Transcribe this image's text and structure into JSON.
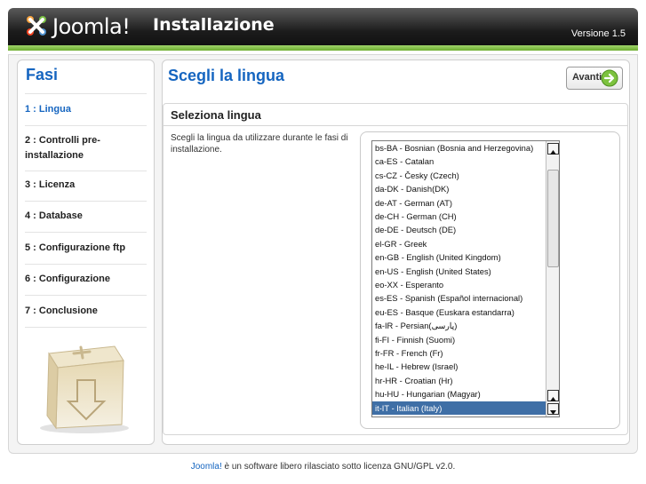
{
  "header": {
    "logo_text": "Joomla!",
    "title": "Installazione",
    "version": "Versione 1.5"
  },
  "sidebar": {
    "title": "Fasi",
    "steps": [
      {
        "label": "1 : Lingua"
      },
      {
        "label": "2 : Controlli pre-installazione"
      },
      {
        "label": "3 : Licenza"
      },
      {
        "label": "4 : Database"
      },
      {
        "label": "5 : Configurazione ftp"
      },
      {
        "label": "6 : Configurazione"
      },
      {
        "label": "7 : Conclusione"
      }
    ]
  },
  "content": {
    "title": "Scegli la lingua",
    "next_label": "Avanti",
    "section_title": "Seleziona lingua",
    "description": "Scegli la lingua da utilizzare durante le fasi di installazione."
  },
  "language_list": {
    "options": [
      "bs-BA - Bosnian (Bosnia and Herzegovina)",
      "ca-ES - Catalan",
      "cs-CZ - Česky (Czech)",
      "da-DK - Danish(DK)",
      "de-AT - German (AT)",
      "de-CH - German (CH)",
      "de-DE - Deutsch (DE)",
      "el-GR - Greek",
      "en-GB - English (United Kingdom)",
      "en-US - English (United States)",
      "eo-XX - Esperanto",
      "es-ES - Spanish (Español internacional)",
      "eu-ES - Basque (Euskara estandarra)",
      "fa-IR - Persian(پارسی)",
      "fi-FI - Finnish (Suomi)",
      "fr-FR - French (Fr)",
      "he-IL - Hebrew (Israel)",
      "hr-HR - Croatian (Hr)",
      "hu-HU - Hungarian (Magyar)",
      "it-IT - Italian (Italy)"
    ],
    "selected": "it-IT - Italian (Italy)"
  },
  "footer": {
    "link_text": "Joomla!",
    "text": " è un software libero rilasciato sotto licenza GNU/GPL v2.0."
  },
  "colors": {
    "accent_blue": "#1565c0",
    "header_green": "#6fae32",
    "selection": "#3f6fa6"
  }
}
